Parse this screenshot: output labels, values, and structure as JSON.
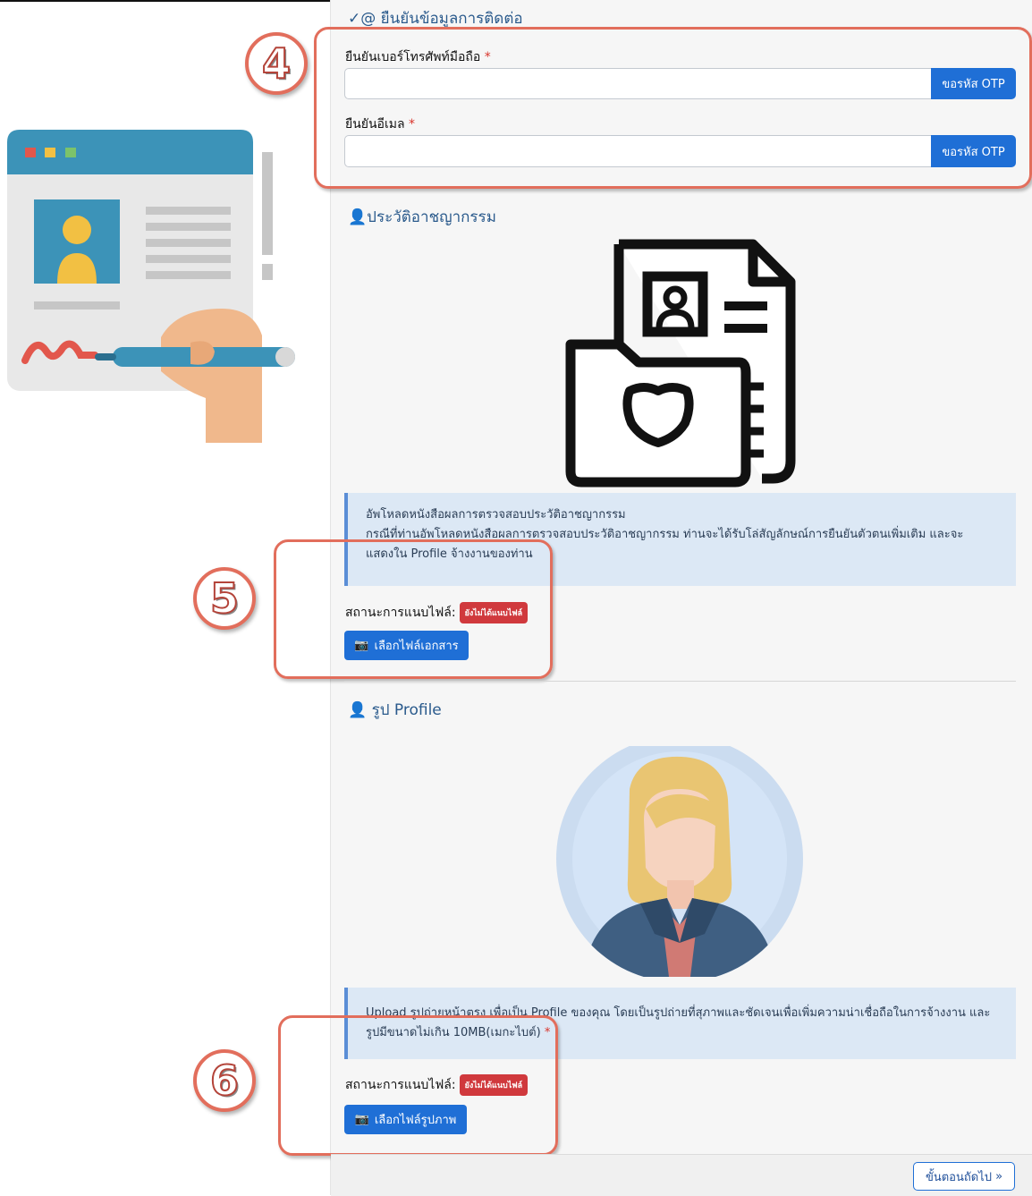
{
  "contact": {
    "title": "@ ยืนยันข้อมูลการติดต่อ",
    "phone_label": "ยืนยันเบอร์โทรศัพท์มือถือ",
    "email_label": "ยืนยันอีเมล",
    "required_mark": "*",
    "phone_value": "",
    "email_value": "",
    "otp_label": "ขอรหัส OTP"
  },
  "criminal": {
    "title": "ประวัติอาชญากรรม",
    "info_line1": "อัพโหลดหนังสือผลการตรวจสอบประวัติอาชญากรรม",
    "info_line2": "กรณีที่ท่านอัพโหลดหนังสือผลการตรวจสอบประวัติอาชญากรรม ท่านจะได้รับโล่สัญลักษณ์การยืนยันตัวตนเพิ่มเติม และจะ",
    "info_line3": "แสดงใน Profile จ้างงานของท่าน",
    "status_label": "สถานะการแนบไฟล์:",
    "status_badge": "ยังไม่ได้แนบไฟล์",
    "button_label": "เลือกไฟล์เอกสาร"
  },
  "profile": {
    "title": "รูป Profile",
    "info_line1": "Upload รูปถ่ายหน้าตรง เพื่อเป็น Profile ของคุณ โดยเป็นรูปถ่ายที่สุภาพและชัดเจนเพื่อเพิ่มความน่าเชื่อถือในการจ้างงาน และ",
    "info_line2": "รูปมีขนาดไม่เกิน 10MB(เมกะไบต์)",
    "required_mark": "*",
    "status_label": "สถานะการแนบไฟล์:",
    "status_badge": "ยังไม่ได้แนบไฟล์",
    "button_label": "เลือกไฟล์รูปภาพ"
  },
  "footer": {
    "next_label": "ขั้นตอนถัดไป"
  },
  "annotations": {
    "n4": "4",
    "n5": "5",
    "n6": "6"
  },
  "colors": {
    "primary": "#1f6fd6",
    "badge": "#d0393d",
    "highlight": "#e26e5c",
    "info_bg": "#dce8f5"
  }
}
